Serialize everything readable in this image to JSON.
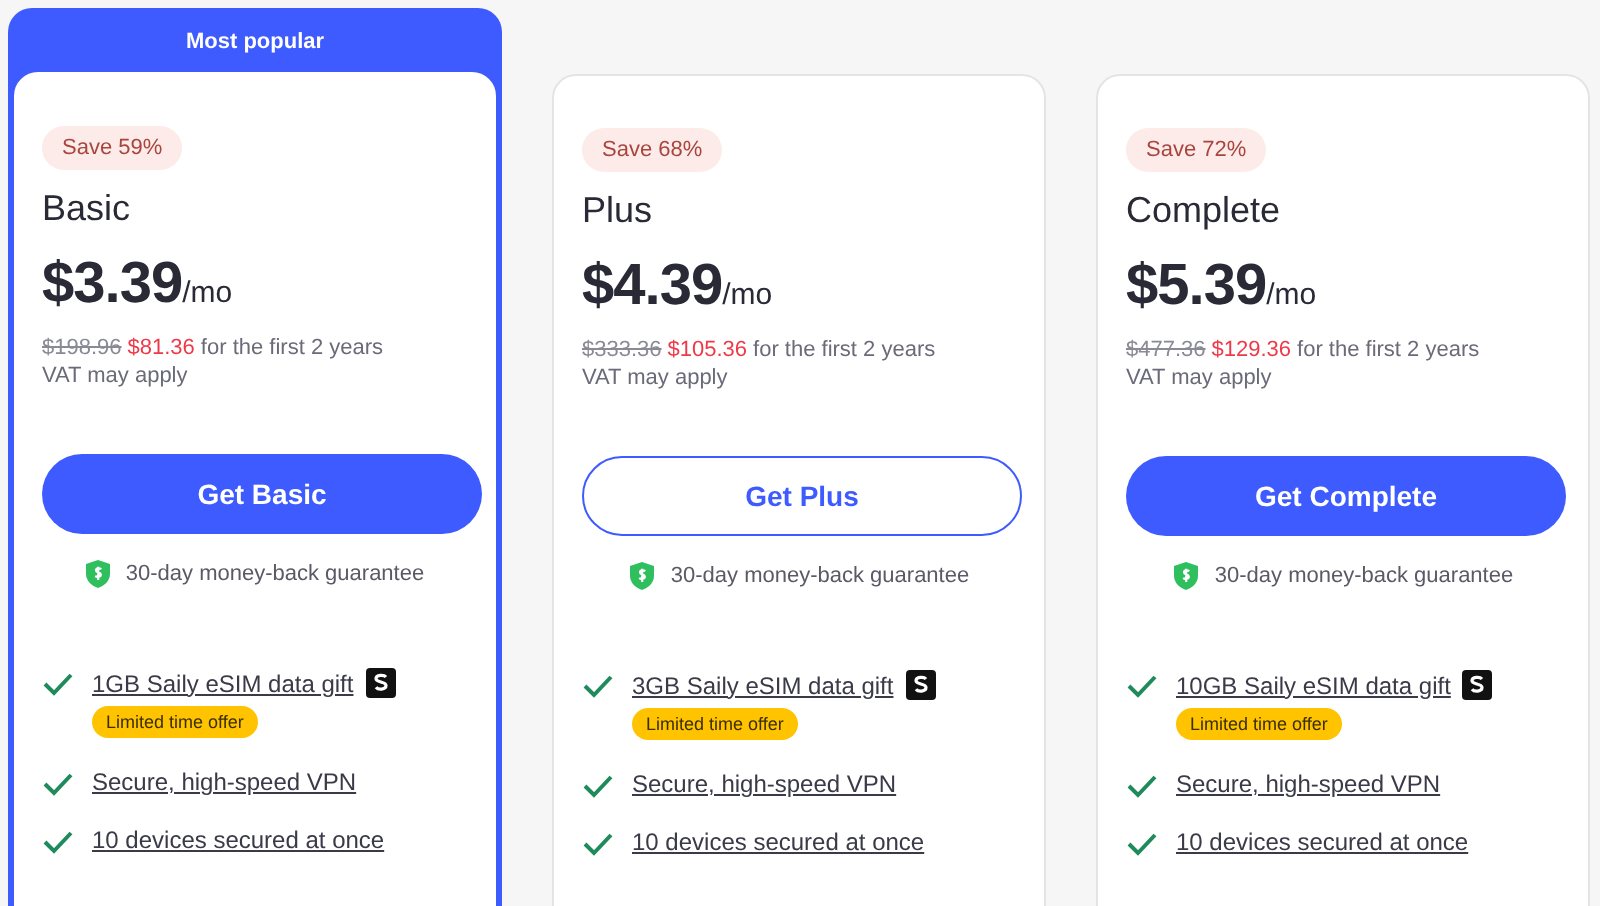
{
  "plans": [
    {
      "banner": "Most popular",
      "featured": true,
      "save": "Save 59%",
      "name": "Basic",
      "price": "$3.39",
      "period": "/mo",
      "old_price": "$198.96",
      "new_price": "$81.36",
      "price_note": "for the first 2 years",
      "vat": "VAT may apply",
      "button": {
        "label": "Get Basic",
        "kind": "filled"
      },
      "guarantee": "30-day money-back guarantee",
      "features": [
        {
          "kind": "gift",
          "text": "1GB Saily eSIM data gift",
          "offer": "Limited time offer"
        },
        {
          "kind": "plain",
          "text": "Secure, high-speed VPN"
        },
        {
          "kind": "plain",
          "text": "10 devices secured at once"
        }
      ]
    },
    {
      "featured": false,
      "save": "Save 68%",
      "name": "Plus",
      "price": "$4.39",
      "period": "/mo",
      "old_price": "$333.36",
      "new_price": "$105.36",
      "price_note": "for the first 2 years",
      "vat": "VAT may apply",
      "button": {
        "label": "Get Plus",
        "kind": "outline"
      },
      "guarantee": "30-day money-back guarantee",
      "features": [
        {
          "kind": "gift",
          "text": "3GB Saily eSIM data gift",
          "offer": "Limited time offer"
        },
        {
          "kind": "plain",
          "text": "Secure, high-speed VPN"
        },
        {
          "kind": "plain",
          "text": "10 devices secured at once"
        }
      ]
    },
    {
      "featured": false,
      "save": "Save 72%",
      "name": "Complete",
      "price": "$5.39",
      "period": "/mo",
      "old_price": "$477.36",
      "new_price": "$129.36",
      "price_note": "for the first 2 years",
      "vat": "VAT may apply",
      "button": {
        "label": "Get Complete",
        "kind": "filled"
      },
      "guarantee": "30-day money-back guarantee",
      "features": [
        {
          "kind": "gift",
          "text": "10GB Saily eSIM data gift",
          "offer": "Limited time offer"
        },
        {
          "kind": "plain",
          "text": "Secure, high-speed VPN"
        },
        {
          "kind": "plain",
          "text": "10 devices secured at once"
        }
      ]
    }
  ]
}
